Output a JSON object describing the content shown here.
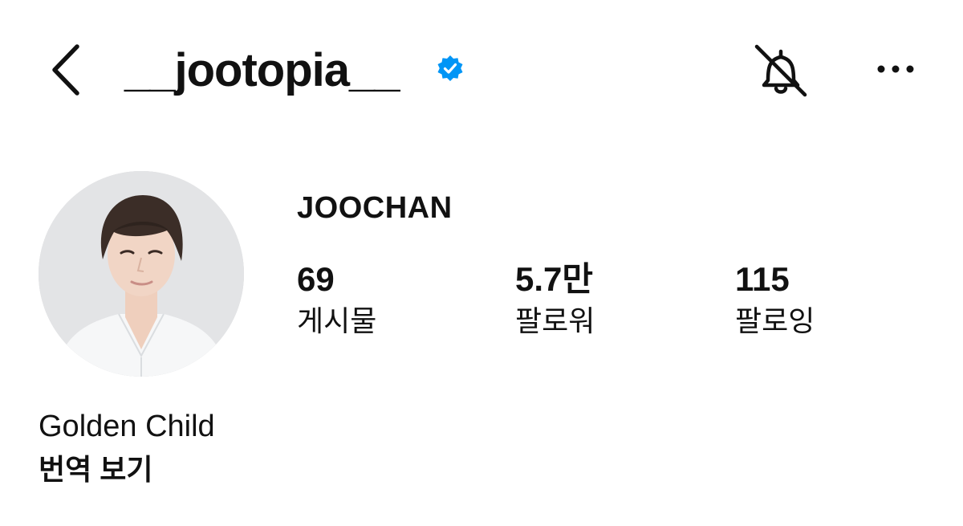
{
  "header": {
    "username": "__jootopia__",
    "verified": true,
    "accent_color": "#0095f6",
    "back_icon": "chevron-left-icon",
    "bell_icon": "bell-off-icon",
    "more_icon": "more-horizontal-icon"
  },
  "profile": {
    "display_name": "JOOCHAN",
    "bio": "Golden Child",
    "translate_label": "번역 보기"
  },
  "stats": {
    "posts": {
      "value": "69",
      "label": "게시물"
    },
    "followers": {
      "value": "5.7만",
      "label": "팔로워"
    },
    "following": {
      "value": "115",
      "label": "팔로잉"
    }
  }
}
